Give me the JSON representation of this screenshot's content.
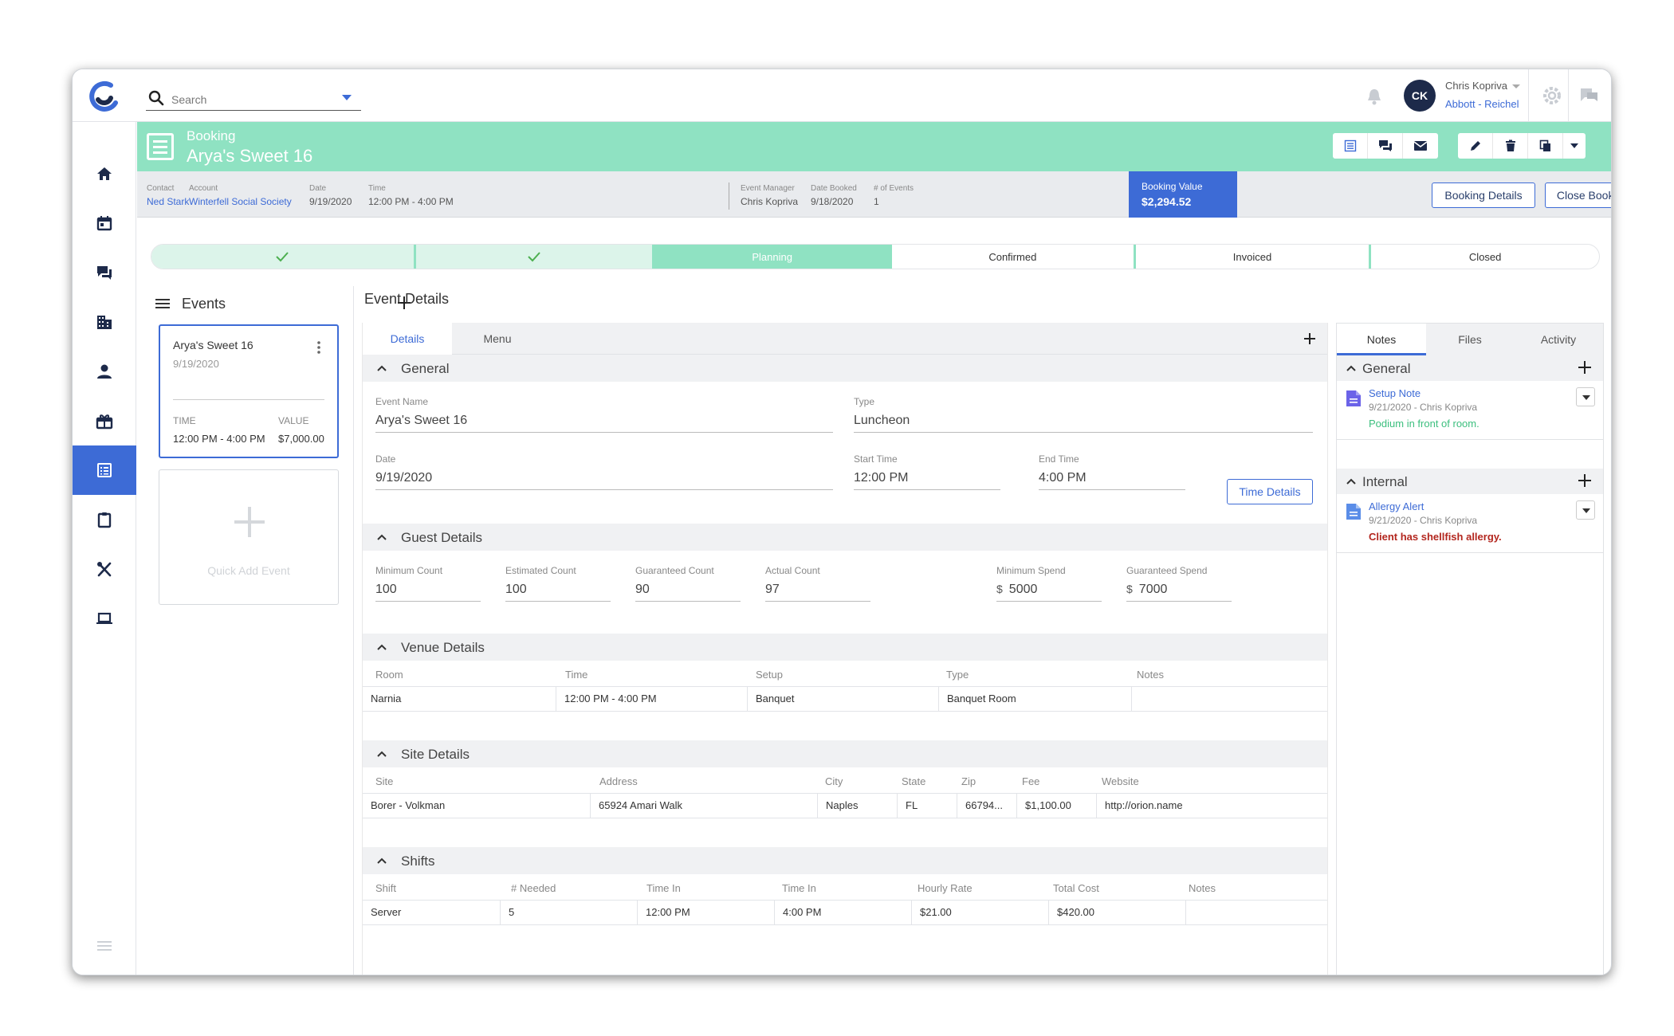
{
  "search": {
    "placeholder": "Search"
  },
  "user": {
    "name": "Chris Kopriva",
    "initials": "CK",
    "org": "Abbott - Reichel"
  },
  "booking": {
    "label": "Booking",
    "title": "Arya's Sweet 16",
    "fields": [
      {
        "label": "Contact",
        "value": "Ned Stark",
        "link": true
      },
      {
        "label": "Account",
        "value": "Winterfell Social Society",
        "link": true
      },
      {
        "label": "Date",
        "value": "9/19/2020",
        "link": false
      },
      {
        "label": "Time",
        "value": "12:00 PM - 4:00 PM",
        "link": false
      },
      {
        "label": "Event Manager",
        "value": "Chris Kopriva",
        "link": false
      },
      {
        "label": "Date Booked",
        "value": "9/18/2020",
        "link": false
      },
      {
        "label": "# of Events",
        "value": "1",
        "link": false
      }
    ],
    "value_label": "Booking Value",
    "value": "$2,294.52",
    "details_button": "Booking Details",
    "close_button": "Close Booking"
  },
  "progress": {
    "steps": [
      {
        "label": "",
        "state": "done"
      },
      {
        "label": "",
        "state": "done"
      },
      {
        "label": "Planning",
        "state": "current"
      },
      {
        "label": "Confirmed",
        "state": "todo"
      },
      {
        "label": "Invoiced",
        "state": "todo"
      },
      {
        "label": "Closed",
        "state": "todo"
      }
    ]
  },
  "events": {
    "heading": "Events",
    "card": {
      "name": "Arya's Sweet 16",
      "date": "9/19/2020",
      "time_label": "TIME",
      "time": "12:00 PM - 4:00 PM",
      "value_label": "VALUE",
      "value": "$7,000.00"
    },
    "quick_add": "Quick Add Event"
  },
  "details": {
    "heading": "Event Details",
    "tabs": [
      "Details",
      "Menu"
    ],
    "general": {
      "title": "General",
      "event_name_label": "Event Name",
      "event_name": "Arya's Sweet 16",
      "type_label": "Type",
      "type": "Luncheon",
      "date_label": "Date",
      "date": "9/19/2020",
      "start_label": "Start Time",
      "start": "12:00 PM",
      "end_label": "End Time",
      "end": "4:00 PM",
      "time_details_button": "Time Details"
    },
    "guest": {
      "title": "Guest Details",
      "fields": [
        {
          "label": "Minimum Count",
          "value": "100"
        },
        {
          "label": "Estimated Count",
          "value": "100"
        },
        {
          "label": "Guaranteed Count",
          "value": "90"
        },
        {
          "label": "Actual Count",
          "value": "97"
        },
        {
          "label": "Minimum Spend",
          "value": "5000",
          "prefix": "$"
        },
        {
          "label": "Guaranteed Spend",
          "value": "7000",
          "prefix": "$"
        }
      ]
    },
    "venue": {
      "title": "Venue Details",
      "columns": [
        "Room",
        "Time",
        "Setup",
        "Type",
        "Notes"
      ],
      "rows": [
        [
          "Narnia",
          "12:00 PM - 4:00 PM",
          "Banquet",
          "Banquet Room",
          ""
        ]
      ]
    },
    "site": {
      "title": "Site Details",
      "columns": [
        "Site",
        "Address",
        "City",
        "State",
        "Zip",
        "Fee",
        "Website"
      ],
      "rows": [
        [
          "Borer - Volkman",
          "65924 Amari Walk",
          "Naples",
          "FL",
          "66794...",
          "$1,100.00",
          "http://orion.name"
        ]
      ]
    },
    "shifts": {
      "title": "Shifts",
      "columns": [
        "Shift",
        "# Needed",
        "Time In",
        "Time In",
        "Hourly Rate",
        "Total Cost",
        "Notes"
      ],
      "rows": [
        [
          "Server",
          "5",
          "12:00 PM",
          "4:00 PM",
          "$21.00",
          "$420.00",
          ""
        ]
      ]
    }
  },
  "notes_panel": {
    "tabs": [
      "Notes",
      "Files",
      "Activity"
    ],
    "general": {
      "title": "General",
      "note": {
        "title": "Setup Note",
        "meta": "9/21/2020 - Chris Kopriva",
        "body": "Podium in front of room.",
        "color": "#3cbf7e"
      }
    },
    "internal": {
      "title": "Internal",
      "note": {
        "title": "Allergy Alert",
        "meta": "9/21/2020 - Chris Kopriva",
        "body": "Client has shellfish allergy.",
        "color": "#b3261e"
      }
    }
  },
  "colors": {
    "accent": "#3d6bd6",
    "header": "#8fe2c2",
    "navy": "#1d2a4a"
  },
  "icons": [
    "logo",
    "search-icon",
    "bell-icon",
    "gear-icon",
    "chat-icon",
    "home-icon",
    "calendar-icon",
    "messages-icon",
    "building-icon",
    "person-icon",
    "gift-icon",
    "booking-icon",
    "clipboard-icon",
    "utensils-icon",
    "laptop-icon",
    "menu-icon",
    "plus-icon",
    "kebab-icon",
    "chevron-up-icon",
    "document-icon",
    "edit-icon",
    "trash-icon",
    "copy-icon",
    "email-icon",
    "check-icon"
  ]
}
